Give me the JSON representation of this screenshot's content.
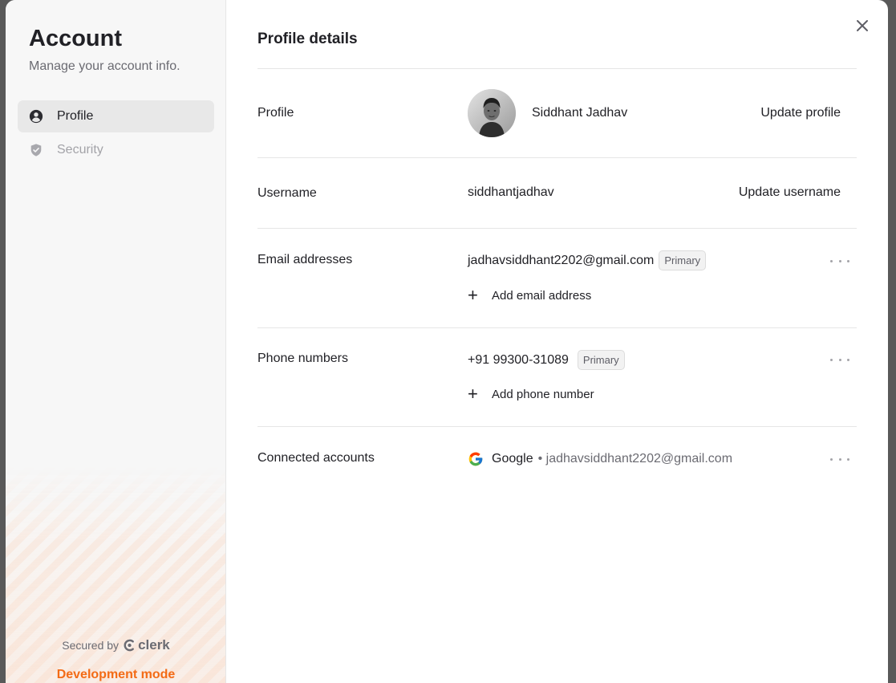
{
  "sidebar": {
    "title": "Account",
    "subtitle": "Manage your account info.",
    "items": [
      {
        "label": "Profile",
        "icon": "user-circle-icon",
        "active": true
      },
      {
        "label": "Security",
        "icon": "shield-icon",
        "active": false
      }
    ],
    "secured_by": "Secured by",
    "brand": "clerk",
    "dev_mode": "Development mode"
  },
  "main": {
    "title": "Profile details",
    "profile": {
      "label": "Profile",
      "name": "Siddhant Jadhav",
      "action": "Update profile"
    },
    "username": {
      "label": "Username",
      "value": "siddhantjadhav",
      "action": "Update username"
    },
    "email": {
      "label": "Email addresses",
      "value": "jadhavsiddhant2202@gmail.com",
      "badge": "Primary",
      "add_label": "Add email address"
    },
    "phone": {
      "label": "Phone numbers",
      "value": "+91 99300-31089",
      "badge": "Primary",
      "add_label": "Add phone number"
    },
    "connected": {
      "label": "Connected accounts",
      "provider": "Google",
      "account": "• jadhavsiddhant2202@gmail.com"
    }
  },
  "colors": {
    "accent_orange": "#f36b16",
    "text": "#212126",
    "muted": "#6b6b72"
  }
}
